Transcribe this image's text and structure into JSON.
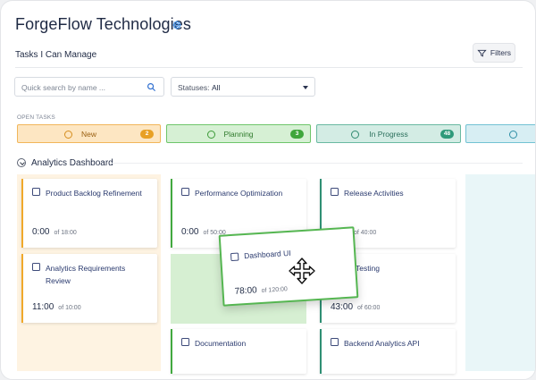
{
  "app": {
    "title": "ForgeFlow Technologies",
    "subtitle": "Tasks I Can Manage"
  },
  "toolbar": {
    "filters_label": "Filters"
  },
  "search": {
    "placeholder": "Quick search by name ..."
  },
  "status_filter": {
    "label": "Statuses:",
    "value": "All"
  },
  "board": {
    "section_label": "OPEN TASKS",
    "columns": [
      {
        "label": "New",
        "count": "2",
        "color": "#f1b65a"
      },
      {
        "label": "Planning",
        "count": "3",
        "color": "#6ec56a"
      },
      {
        "label": "In Progress",
        "count": "48",
        "color": "#69b9a1"
      }
    ],
    "group": {
      "title": "Analytics Dashboard"
    }
  },
  "cards": {
    "c1": {
      "title": "Product Backlog Refinement",
      "time": "0:00",
      "of": "of 18:00"
    },
    "c2": {
      "title": "Analytics Requirements Review",
      "time": "11:00",
      "of": "of 10:00"
    },
    "c3": {
      "title": "Performance Optimization",
      "time": "0:00",
      "of": "of 50:00"
    },
    "c4": {
      "title": "Documentation"
    },
    "c5": {
      "title": "Release Activities",
      "of": "of 40:00"
    },
    "c6": {
      "title": "Testing",
      "time": "43:00",
      "of": "of 60:00"
    },
    "c7": {
      "title": "Backend Analytics API"
    }
  },
  "dragging": {
    "title": "Dashboard UI",
    "time": "78:00",
    "of": "of 120:00"
  }
}
